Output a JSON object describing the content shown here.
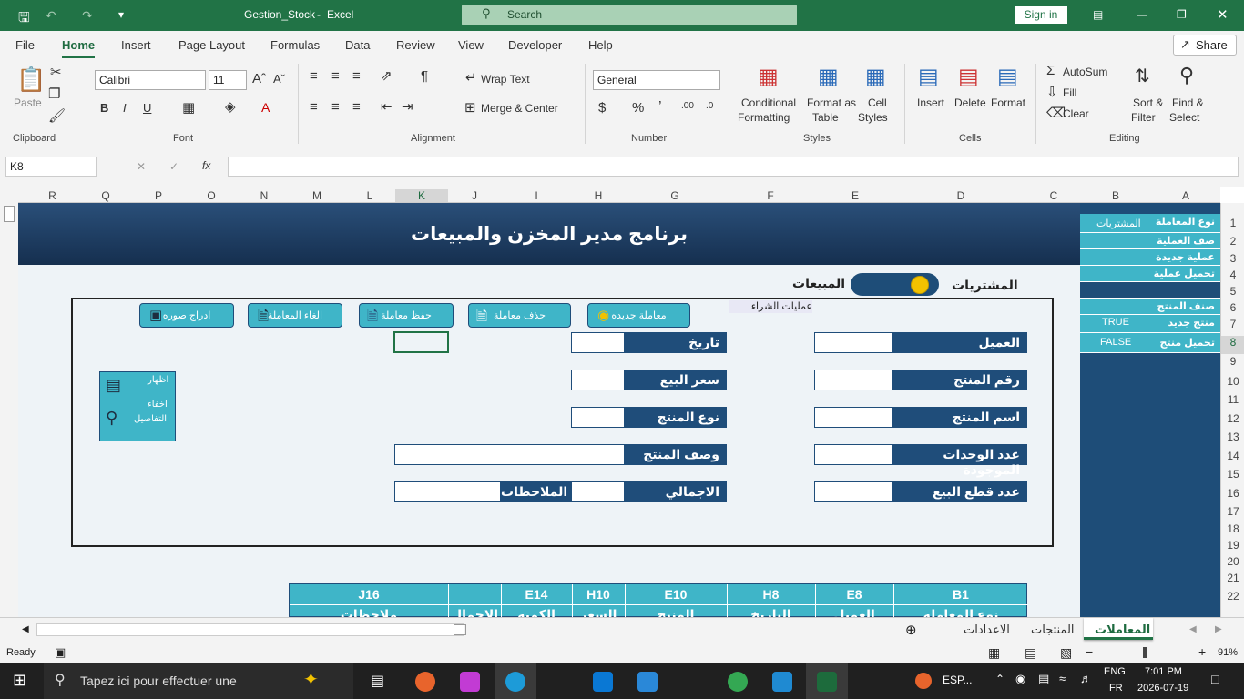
{
  "app": {
    "file_title": "Gestion_Stock",
    "app_name": "Excel",
    "search_label": "Search",
    "signin": "Sign in",
    "share": "Share"
  },
  "menu": [
    "File",
    "Home",
    "Insert",
    "Page Layout",
    "Formulas",
    "Data",
    "Review",
    "View",
    "Developer",
    "Help"
  ],
  "ribbon": {
    "clipboard": {
      "paste": "Paste",
      "group": "Clipboard"
    },
    "font": {
      "name": "Calibri",
      "size": "11",
      "group": "Font"
    },
    "alignment": {
      "wrap": "Wrap Text",
      "merge": "Merge & Center",
      "group": "Alignment"
    },
    "number": {
      "format": "General",
      "group": "Number"
    },
    "styles": {
      "cond1": "Conditional",
      "cond2": "Formatting",
      "table1": "Format as",
      "table2": "Table",
      "cell1": "Cell",
      "cell2": "Styles",
      "group": "Styles"
    },
    "cells": {
      "insert": "Insert",
      "delete": "Delete",
      "format": "Format",
      "group": "Cells"
    },
    "editing": {
      "autosum": "AutoSum",
      "fill": "Fill",
      "clear": "Clear",
      "sort1": "Sort &",
      "sort2": "Filter",
      "find1": "Find &",
      "find2": "Select",
      "group": "Editing"
    }
  },
  "formula": {
    "namebox": "K8",
    "fx": "fx",
    "value": ""
  },
  "columns": [
    "R",
    "Q",
    "P",
    "O",
    "N",
    "M",
    "L",
    "K",
    "J",
    "I",
    "H",
    "G",
    "F",
    "E",
    "D",
    "C",
    "B",
    "A"
  ],
  "rows": [
    "1",
    "2",
    "3",
    "4",
    "5",
    "6",
    "7",
    "8",
    "9",
    "10",
    "11",
    "12",
    "13",
    "14",
    "15",
    "16",
    "17",
    "18",
    "19",
    "20",
    "21",
    "22"
  ],
  "sheet": {
    "title": "برنامج مدير  المخزن والمبيعات",
    "toggle_left": "المبيعات",
    "toggle_right": "المشتريات",
    "mode_label": "عمليات الشراء",
    "buttons": [
      "معاملة جديده",
      "حذف معاملة",
      "حفظ معاملة",
      "الغاء المعاملة",
      "ادراج صوره"
    ],
    "details_line1": "اظهار",
    "details_line2": "اخفاء",
    "details_line3": "التفاصيل",
    "right_labels": [
      "العميل",
      "رقم المنتج",
      "اسم المنتج",
      "عدد الوحدات الموجودة",
      "عدد قطع البيع"
    ],
    "mid_labels": [
      "تاريخ",
      "سعر البيع",
      "نوع المنتج",
      "وصف المنتج",
      "الاجمالي"
    ],
    "notes_label": "الملاحظات",
    "table_refs": [
      "B1",
      "E8",
      "H8",
      "E10",
      "H10",
      "E14",
      "",
      "J16"
    ],
    "table_sub": [
      "نوع المعاملة",
      "العميل",
      "التاريخ",
      "المنتج",
      "السعر",
      "الكمية",
      "الاجمال",
      "ملاحظات"
    ]
  },
  "side": [
    {
      "a": "نوع المعاملة",
      "b": "المشتريات"
    },
    {
      "a": "صف العملية",
      "b": ""
    },
    {
      "a": "عملية جديدة",
      "b": ""
    },
    {
      "a": "تحميل عملية",
      "b": ""
    },
    {
      "a": "",
      "b": ""
    },
    {
      "a": "صنف المنتج",
      "b": ""
    },
    {
      "a": "منتج جديد",
      "b": "TRUE"
    },
    {
      "a": "تحميل منتج",
      "b": "FALSE"
    }
  ],
  "tabs": [
    "المعاملات",
    "المنتجات",
    "الاعدادات"
  ],
  "status": {
    "ready": "Ready",
    "zoom": "91%"
  },
  "taskbar": {
    "search": "Tapez ici pour effectuer une",
    "lang1": "ENG",
    "lang2": "FR",
    "time": "7:01 PM",
    "date": "2026-07-19",
    "esp": "ESP..."
  }
}
